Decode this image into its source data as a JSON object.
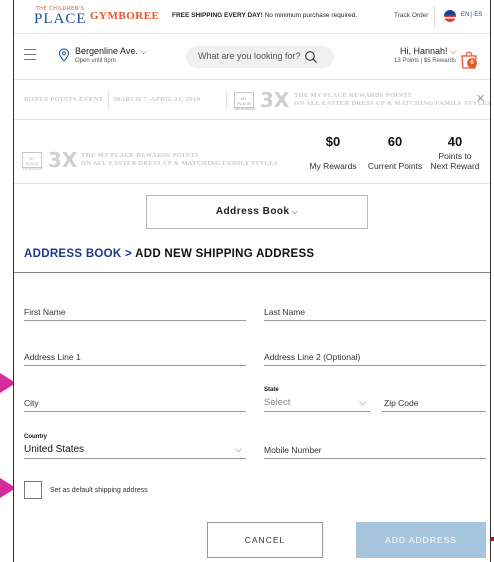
{
  "topbar": {
    "tcp_logo_small": "THE CHILDREN'S",
    "tcp_logo_big": "PLACE",
    "gymboree_logo": "GYMBOREE",
    "shipping_bold": "FREE SHIPPING EVERY DAY!",
    "shipping_rest": " No minimum purchase required.",
    "track_order": "Track Order",
    "language": "EN | ES"
  },
  "header": {
    "store_name": "Bergenline Ave.",
    "store_hours": "Open until 8pm",
    "search_placeholder": "What are you looking for?",
    "greeting": "Hi, Hannah!",
    "points_summary": "13 Points  |  $5 Rewards",
    "bag_count": "0"
  },
  "promo": {
    "event": "BONUS POINTS EVENT",
    "dates": "MARCH 7–APRIL 21, 2019",
    "mini_logo": "MY PLACE REWARDS",
    "multiplier": "3X",
    "line1": "THE MY PLACE REWARDS POINTS",
    "line2": "ON ALL EASTER DRESS UP & MATCHING FAMILY STYLES"
  },
  "rewards": {
    "mini_logo": "MY PLACE REWARDS",
    "multiplier": "3X",
    "line1": "THE MY PLACE REWARDS POINTS",
    "line2": "ON ALL EASTER DRESS UP & MATCHING FAMILY STYLES",
    "my_rewards_value": "$0",
    "my_rewards_label": "My Rewards",
    "current_points_value": "60",
    "current_points_label": "Current Points",
    "next_reward_value": "40",
    "next_reward_label_1": "Points to",
    "next_reward_label_2": "Next Reward"
  },
  "address_book_dropdown": "Address Book",
  "page_title": {
    "link": "ADDRESS BOOK >",
    "rest": " ADD NEW SHIPPING ADDRESS"
  },
  "form": {
    "first_name": "First Name",
    "last_name": "Last Name",
    "address_line_1": "Address Line 1",
    "address_line_2": "Address Line 2 (Optional)",
    "city": "City",
    "state_label": "State",
    "state_value": "Select",
    "zip_code": "Zip Code",
    "country_label": "Country",
    "country_value": "United States",
    "mobile_number": "Mobile Number",
    "default_checkbox_label": "Set as default shipping address"
  },
  "buttons": {
    "cancel": "CANCEL",
    "add_address": "ADD ADDRESS"
  },
  "colors": {
    "brand_blue": "#1b3a8c",
    "gymboree_orange": "#e8562a",
    "add_button": "#a6c4db",
    "annotation_arrow": "#d62b9c"
  }
}
